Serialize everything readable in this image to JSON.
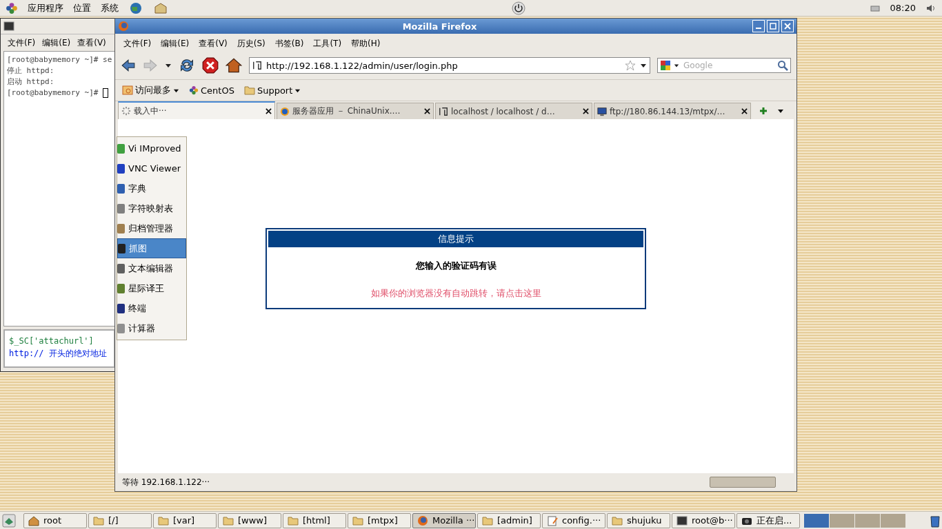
{
  "top_panel": {
    "menus": [
      "应用程序",
      "位置",
      "系统"
    ],
    "clock": "08:20"
  },
  "terminal": {
    "menus": [
      "文件(F)",
      "编辑(E)",
      "查看(V)"
    ],
    "lines": [
      "[root@babymemory ~]# se",
      "停止 httpd:",
      "启动 httpd:",
      "[root@babymemory ~]# "
    ],
    "editor_lines": [
      {
        "kind": "code",
        "text": "$_SC['attachurl']"
      },
      {
        "kind": "comment",
        "text": "http:// 开头的绝对地址"
      }
    ]
  },
  "firefox": {
    "title": "Mozilla Firefox",
    "menus": [
      "文件(F)",
      "编辑(E)",
      "查看(V)",
      "历史(S)",
      "书签(B)",
      "工具(T)",
      "帮助(H)"
    ],
    "url": "http://192.168.1.122/admin/user/login.php",
    "search_placeholder": "Google",
    "bookmarks": [
      {
        "label": "访问最多",
        "kind": "menu"
      },
      {
        "label": "CentOS",
        "kind": "link"
      },
      {
        "label": "Support",
        "kind": "folder"
      }
    ],
    "tabs": [
      {
        "label": "载入中···",
        "selected": true,
        "kind": "loading"
      },
      {
        "label": "服务器应用 － ChinaUnix.…",
        "selected": false,
        "kind": "site"
      },
      {
        "label": "localhost / localhost / d…",
        "selected": false,
        "kind": "pma"
      },
      {
        "label": "ftp://180.86.144.13/mtpx/…",
        "selected": false,
        "kind": "ftp"
      }
    ],
    "context_menu": [
      {
        "label": "Vi IMproved",
        "selected": false
      },
      {
        "label": "VNC Viewer",
        "selected": false
      },
      {
        "label": "字典",
        "selected": false
      },
      {
        "label": "字符映射表",
        "selected": false
      },
      {
        "label": "归档管理器",
        "selected": false
      },
      {
        "label": "抓图",
        "selected": true
      },
      {
        "label": "文本编辑器",
        "selected": false
      },
      {
        "label": "星际译王",
        "selected": false
      },
      {
        "label": "终端",
        "selected": false
      },
      {
        "label": "计算器",
        "selected": false
      }
    ],
    "dialog": {
      "title": "信息提示",
      "message": "您输入的验证码有误",
      "link": "如果你的浏览器没有自动跳转，请点击这里"
    },
    "status": "等待 192.168.1.122···",
    "progress": {
      "level": 0
    }
  },
  "taskbar": [
    {
      "label": "root",
      "kind": "home",
      "selected": false
    },
    {
      "label": "[/]",
      "kind": "folder",
      "selected": false
    },
    {
      "label": "[var]",
      "kind": "folder",
      "selected": false
    },
    {
      "label": "[www]",
      "kind": "folder",
      "selected": false
    },
    {
      "label": "[html]",
      "kind": "folder",
      "selected": false
    },
    {
      "label": "[mtpx]",
      "kind": "folder",
      "selected": false
    },
    {
      "label": "Mozilla ···",
      "kind": "firefox",
      "selected": true
    },
    {
      "label": "[admin]",
      "kind": "folder",
      "selected": false
    },
    {
      "label": "config.···",
      "kind": "editor",
      "selected": false
    },
    {
      "label": "shujuku",
      "kind": "folder",
      "selected": false
    },
    {
      "label": "root@b···",
      "kind": "terminal",
      "selected": false
    },
    {
      "label": "正在启...",
      "kind": "camera",
      "selected": false
    }
  ]
}
